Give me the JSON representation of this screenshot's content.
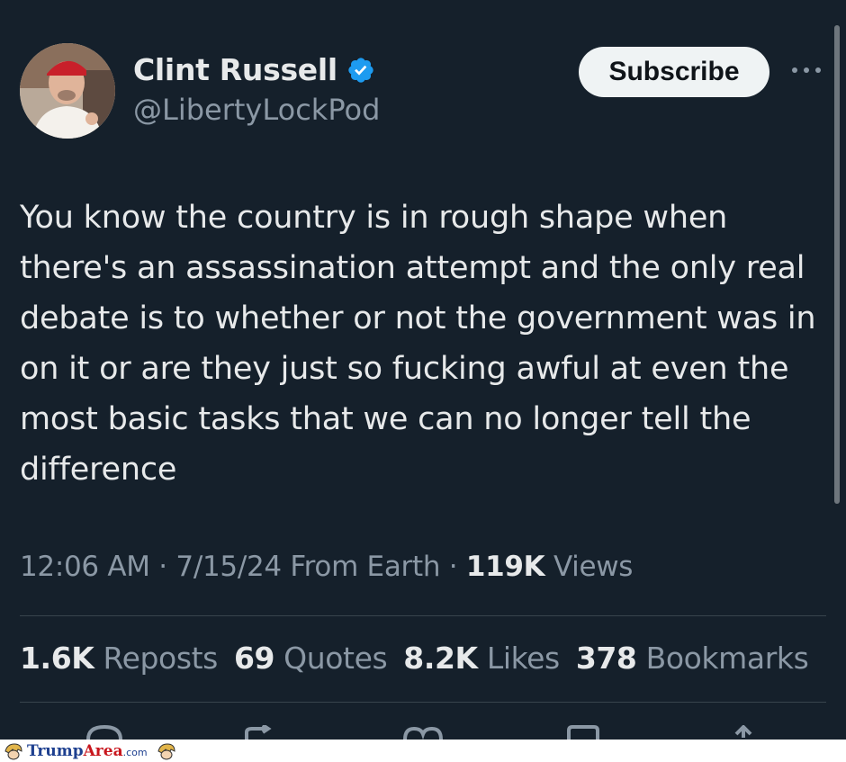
{
  "author": {
    "display_name": "Clint Russell",
    "handle": "@LibertyLockPod",
    "verified": true,
    "verified_color": "#1d9bf0"
  },
  "header": {
    "subscribe_label": "Subscribe",
    "more_icon": "more-horizontal-icon"
  },
  "tweet": {
    "text": "You know the country is in rough shape when there's an assassination attempt and the only real debate is to whether or not the government was in on it or are they just so fucking awful at even the most basic tasks that we can no longer tell the difference"
  },
  "meta": {
    "time": "12:06 AM",
    "sep1": " · ",
    "date": "7/15/24",
    "source": " From Earth",
    "sep2": " · ",
    "views_count": "119K",
    "views_label": " Views"
  },
  "stats": [
    {
      "count": "1.6K",
      "label": "Reposts"
    },
    {
      "count": "69",
      "label": "Quotes"
    },
    {
      "count": "8.2K",
      "label": "Likes"
    },
    {
      "count": "378",
      "label": "Bookmarks"
    }
  ],
  "actions": [
    "reply-icon",
    "repost-icon",
    "like-icon",
    "bookmark-icon",
    "share-icon"
  ],
  "footer": {
    "brand_part1": "Trump",
    "brand_part2": "Area",
    "brand_part3": ".com"
  },
  "colors": {
    "background": "#15202b",
    "text": "#e7e9ea",
    "secondary": "#8b98a5",
    "divider": "#38444d"
  }
}
